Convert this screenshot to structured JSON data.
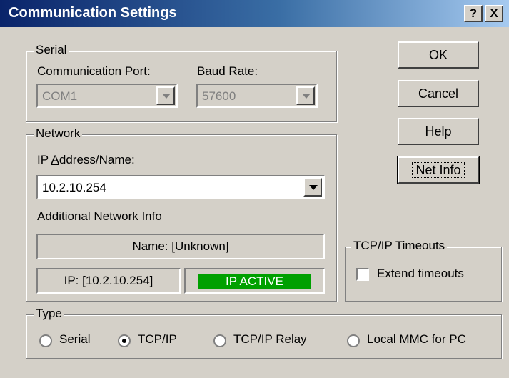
{
  "window": {
    "title": "Communication Settings",
    "help_glyph": "?",
    "close_glyph": "X"
  },
  "serial": {
    "legend": "Serial",
    "port_label_u": "C",
    "port_label_rest": "ommunication Port:",
    "port_value": "COM1",
    "baud_label_u": "B",
    "baud_label_rest": "aud Rate:",
    "baud_value": "57600"
  },
  "network": {
    "legend": "Network",
    "ip_label_pre": "IP ",
    "ip_label_u": "A",
    "ip_label_rest": "ddress/Name:",
    "ip_value": "10.2.10.254",
    "additional_label": "Additional Network Info",
    "name_info": "Name: [Unknown]",
    "ip_info": "IP: [10.2.10.254]",
    "status": "IP ACTIVE",
    "status_color": "#00a000"
  },
  "buttons": {
    "ok": "OK",
    "cancel": "Cancel",
    "help": "Help",
    "net_info": "Net Info"
  },
  "timeouts": {
    "legend": "TCP/IP Timeouts",
    "extend_label": "Extend timeouts",
    "extend_checked": false
  },
  "type": {
    "legend": "Type",
    "options": [
      {
        "u": "S",
        "rest": "erial",
        "selected": false
      },
      {
        "u": "T",
        "rest": "CP/IP",
        "selected": true
      },
      {
        "pre": "TCP/IP ",
        "u": "R",
        "rest": "elay",
        "selected": false
      },
      {
        "pre": "Local MMC for PC",
        "u": "",
        "rest": "",
        "selected": false
      }
    ]
  }
}
